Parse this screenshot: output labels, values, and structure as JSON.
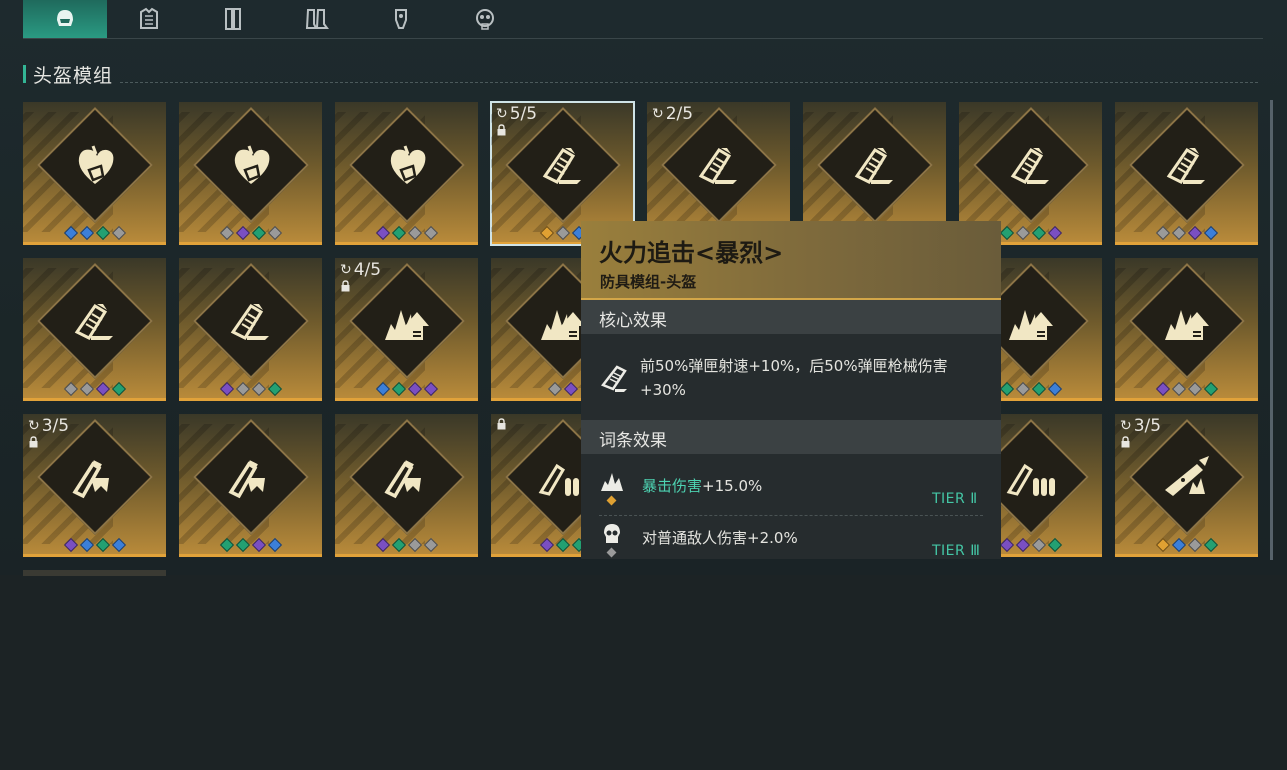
{
  "tabs": [
    {
      "name": "helmet",
      "active": true
    },
    {
      "name": "armor",
      "active": false
    },
    {
      "name": "gloves",
      "active": false
    },
    {
      "name": "boots",
      "active": false
    },
    {
      "name": "gauntlet",
      "active": false
    },
    {
      "name": "mask",
      "active": false
    }
  ],
  "section_title": "头盔模组",
  "gem_colors": {
    "blue": "#3c7fd8",
    "purple": "#7a4fc2",
    "green": "#23a072",
    "gray": "#9a9a9a",
    "gold": "#e0a132"
  },
  "cards": [
    {
      "icon": "heart-icon",
      "gems": [
        "blue",
        "blue",
        "green",
        "gray"
      ]
    },
    {
      "icon": "heart-icon",
      "gems": [
        "gray",
        "purple",
        "green",
        "gray"
      ]
    },
    {
      "icon": "heart-icon",
      "gems": [
        "purple",
        "green",
        "gray",
        "gray"
      ]
    },
    {
      "icon": "magazine-icon",
      "progress": "5/5",
      "locked": true,
      "selected": true,
      "gems": [
        "gold",
        "gray",
        "blue"
      ]
    },
    {
      "icon": "magazine-icon",
      "progress": "2/5",
      "gems": []
    },
    {
      "icon": "magazine-icon",
      "gems": []
    },
    {
      "icon": "magazine-icon",
      "gems": [
        "green",
        "gray",
        "green",
        "purple"
      ]
    },
    {
      "icon": "magazine-icon",
      "gems": [
        "gray",
        "gray",
        "purple",
        "blue"
      ]
    },
    {
      "icon": "magazine-icon",
      "gems": [
        "gray",
        "gray",
        "purple",
        "green"
      ]
    },
    {
      "icon": "magazine-icon",
      "gems": [
        "purple",
        "gray",
        "gray",
        "green"
      ]
    },
    {
      "icon": "burst-arrow-icon",
      "progress": "4/5",
      "locked": true,
      "gems": [
        "blue",
        "green",
        "purple",
        "purple"
      ]
    },
    {
      "icon": "burst-arrow-icon",
      "gems": [
        "gray",
        "purple"
      ]
    },
    {
      "icon": "burst-arrow-icon",
      "gems": []
    },
    {
      "icon": "burst-arrow-icon",
      "gems": []
    },
    {
      "icon": "burst-arrow-icon",
      "gems": [
        "green",
        "gray",
        "green",
        "blue"
      ]
    },
    {
      "icon": "burst-arrow-icon",
      "gems": [
        "purple",
        "gray",
        "gray",
        "green"
      ]
    },
    {
      "icon": "gun-barrel-icon",
      "progress": "3/5",
      "locked": true,
      "gems": [
        "purple",
        "blue",
        "green",
        "blue"
      ]
    },
    {
      "icon": "gun-barrel-icon",
      "gems": [
        "green",
        "green",
        "purple",
        "blue"
      ]
    },
    {
      "icon": "gun-barrel-icon",
      "gems": [
        "purple",
        "green",
        "gray",
        "gray"
      ]
    },
    {
      "icon": "ammo-icon",
      "locked_top": true,
      "gems": [
        "purple",
        "green",
        "green"
      ]
    },
    {
      "icon": "ammo-icon",
      "gems": []
    },
    {
      "icon": "ammo-icon",
      "gems": []
    },
    {
      "icon": "ammo-icon",
      "gems": [
        "purple",
        "purple",
        "gray",
        "green"
      ]
    },
    {
      "icon": "rifle-icon",
      "progress": "3/5",
      "locked": true,
      "gems": [
        "gold",
        "blue",
        "gray",
        "green"
      ]
    }
  ],
  "tooltip": {
    "title": "火力追击<暴烈>",
    "subtitle": "防具模组-头盔",
    "core_header": "核心效果",
    "core_text": "前50%弹匣射速+10%，后50%弹匣枪械伤害+30%",
    "affix_header": "词条效果",
    "affixes": [
      {
        "name": "暴击伤害",
        "value": "+15.0%",
        "highlight": true,
        "tier": "TIER Ⅱ",
        "gem": "gold",
        "icon": "crit-icon"
      },
      {
        "name": "对普通敌人伤害",
        "value": "+2.0%",
        "highlight": false,
        "tier": "TIER Ⅲ",
        "gem": "gray",
        "icon": "skull-icon"
      }
    ]
  }
}
